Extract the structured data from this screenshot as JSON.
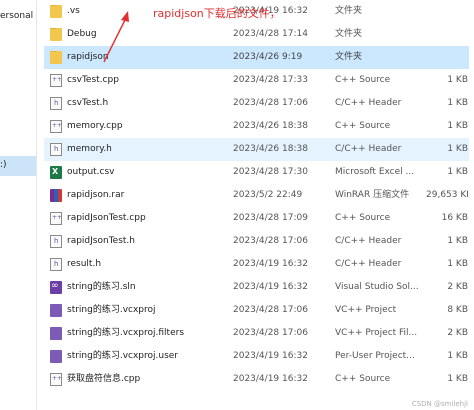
{
  "nav": {
    "label_personal": "ersonal",
    "label_c": ":)"
  },
  "files": [
    {
      "name": ".vs",
      "date": "2023/4/19 16:32",
      "type": "文件夹",
      "size": "",
      "icon": "folder-icon"
    },
    {
      "name": "Debug",
      "date": "2023/4/28 17:14",
      "type": "文件夹",
      "size": "",
      "icon": "folder-icon"
    },
    {
      "name": "rapidjson",
      "date": "2023/4/26 9:19",
      "type": "文件夹",
      "size": "",
      "icon": "folder-icon"
    },
    {
      "name": "csvTest.cpp",
      "date": "2023/4/28 17:33",
      "type": "C++ Source",
      "size": "1 KB",
      "icon": "cpp-file-icon"
    },
    {
      "name": "csvTest.h",
      "date": "2023/4/28 17:06",
      "type": "C/C++ Header",
      "size": "1 KB",
      "icon": "header-file-icon"
    },
    {
      "name": "memory.cpp",
      "date": "2023/4/26 18:38",
      "type": "C++ Source",
      "size": "1 KB",
      "icon": "cpp-file-icon"
    },
    {
      "name": "memory.h",
      "date": "2023/4/26 18:38",
      "type": "C/C++ Header",
      "size": "1 KB",
      "icon": "header-file-icon"
    },
    {
      "name": "output.csv",
      "date": "2023/4/28 17:30",
      "type": "Microsoft Excel ...",
      "size": "1 KB",
      "icon": "excel-csv-icon"
    },
    {
      "name": "rapidjson.rar",
      "date": "2023/5/2 22:49",
      "type": "WinRAR 压缩文件",
      "size": "29,653 KB",
      "icon": "winrar-archive-icon"
    },
    {
      "name": "rapidJsonTest.cpp",
      "date": "2023/4/28 17:09",
      "type": "C++ Source",
      "size": "16 KB",
      "icon": "cpp-file-icon"
    },
    {
      "name": "rapidJsonTest.h",
      "date": "2023/4/28 17:06",
      "type": "C/C++ Header",
      "size": "1 KB",
      "icon": "header-file-icon"
    },
    {
      "name": "result.h",
      "date": "2023/4/19 16:32",
      "type": "C/C++ Header",
      "size": "1 KB",
      "icon": "header-file-icon"
    },
    {
      "name": "string的练习.sln",
      "date": "2023/4/19 16:32",
      "type": "Visual Studio Sol...",
      "size": "2 KB",
      "icon": "visual-studio-solution-icon"
    },
    {
      "name": "string的练习.vcxproj",
      "date": "2023/4/28 17:06",
      "type": "VC++ Project",
      "size": "8 KB",
      "icon": "vcxproj-icon"
    },
    {
      "name": "string的练习.vcxproj.filters",
      "date": "2023/4/28 17:06",
      "type": "VC++ Project Fil...",
      "size": "2 KB",
      "icon": "vcxproj-icon"
    },
    {
      "name": "string的练习.vcxproj.user",
      "date": "2023/4/19 16:32",
      "type": "Per-User Project...",
      "size": "1 KB",
      "icon": "vcxproj-icon"
    },
    {
      "name": "获取盘符信息.cpp",
      "date": "2023/4/19 16:32",
      "type": "C++ Source",
      "size": "1 KB",
      "icon": "cpp-file-icon"
    }
  ],
  "annotation": "rapidjson下载后的文件，",
  "watermark": "CSDN @smilehjl"
}
